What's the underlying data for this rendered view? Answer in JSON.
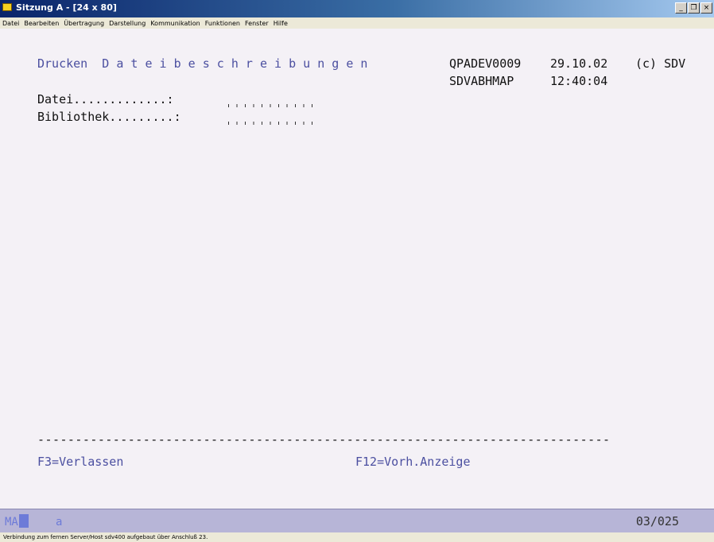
{
  "window": {
    "title": "Sitzung A - [24 x 80]",
    "btn_min": "_",
    "btn_restore": "❐",
    "btn_close": "×"
  },
  "menu": [
    "Datei",
    "Bearbeiten",
    "Übertragung",
    "Darstellung",
    "Kommunikation",
    "Funktionen",
    "Fenster",
    "Hilfe"
  ],
  "screen": {
    "program_title": "Drucken  D a t e i b e s c h r e i b u n g e n",
    "program_id": "QPADEV0009",
    "date": "29.10.02",
    "copyright": "(c) SDV",
    "map_id": "SDVABHMAP",
    "time": "12:40:04",
    "field_datei_label": "Datei.............:",
    "field_bibliothek_label": "Bibliothek.........:",
    "field_datei_value": "",
    "field_bibliothek_value": "",
    "separator": "----------------------------------------------------------------------------",
    "f3": "F3=Verlassen",
    "f12": "F12=Vorh.Anzeige"
  },
  "oia": {
    "mode": "MA",
    "indicator": "a",
    "cursor_position": "03/025"
  },
  "status_text": "Verbindung zum fernen Server/Host sdv400 aufgebaut über Anschluß 23.",
  "colors": {
    "screen_bg": "#f4f1f6",
    "field_text": "#4b4fa0",
    "title_gradient_start": "#0a246a",
    "oia_bg": "#b7b5d7"
  }
}
